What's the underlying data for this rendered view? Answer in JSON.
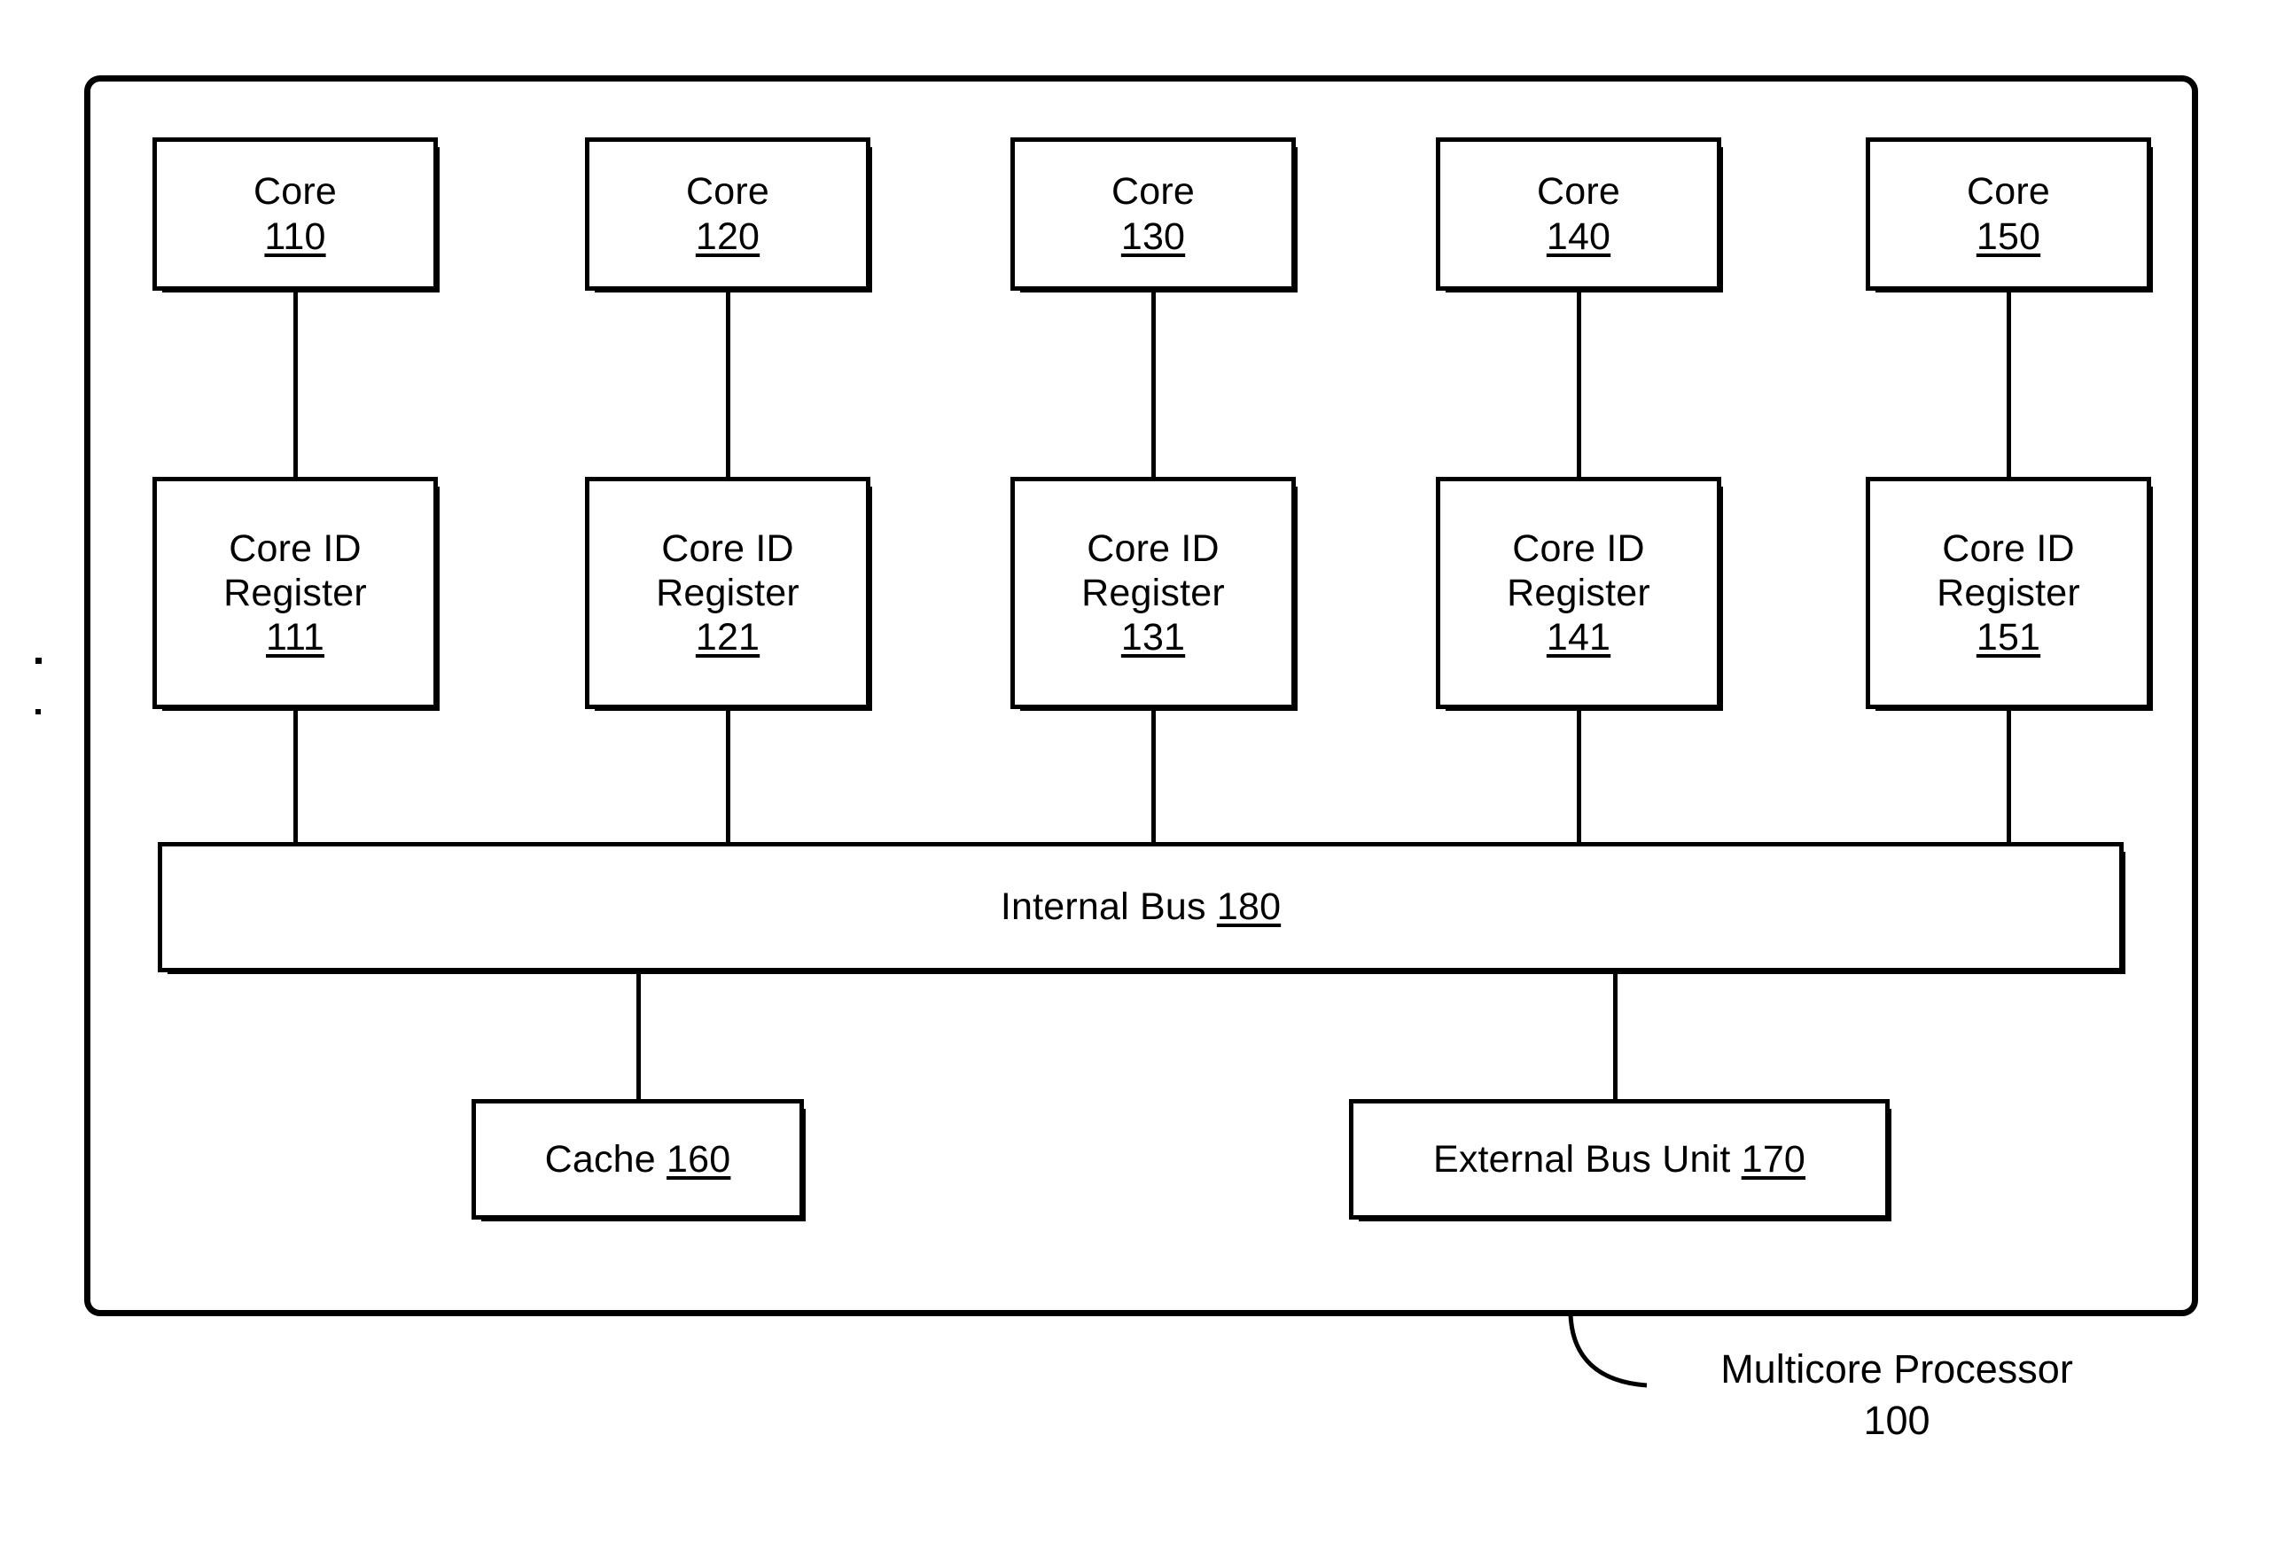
{
  "figure": {
    "title_label": "Multicore Processor",
    "title_ref": "100",
    "cores": [
      {
        "label": "Core",
        "ref": "110"
      },
      {
        "label": "Core",
        "ref": "120"
      },
      {
        "label": "Core",
        "ref": "130"
      },
      {
        "label": "Core",
        "ref": "140"
      },
      {
        "label": "Core",
        "ref": "150"
      }
    ],
    "registers": [
      {
        "line1": "Core ID",
        "line2": "Register",
        "ref": "111"
      },
      {
        "line1": "Core ID",
        "line2": "Register",
        "ref": "121"
      },
      {
        "line1": "Core ID",
        "line2": "Register",
        "ref": "131"
      },
      {
        "line1": "Core ID",
        "line2": "Register",
        "ref": "141"
      },
      {
        "line1": "Core ID",
        "line2": "Register",
        "ref": "151"
      }
    ],
    "bus": {
      "label": "Internal Bus",
      "ref": "180"
    },
    "cache": {
      "label": "Cache",
      "ref": "160"
    },
    "external_bus_unit": {
      "label": "External Bus Unit",
      "ref": "170"
    },
    "colors": {
      "stroke": "#000000",
      "background": "#ffffff"
    }
  }
}
